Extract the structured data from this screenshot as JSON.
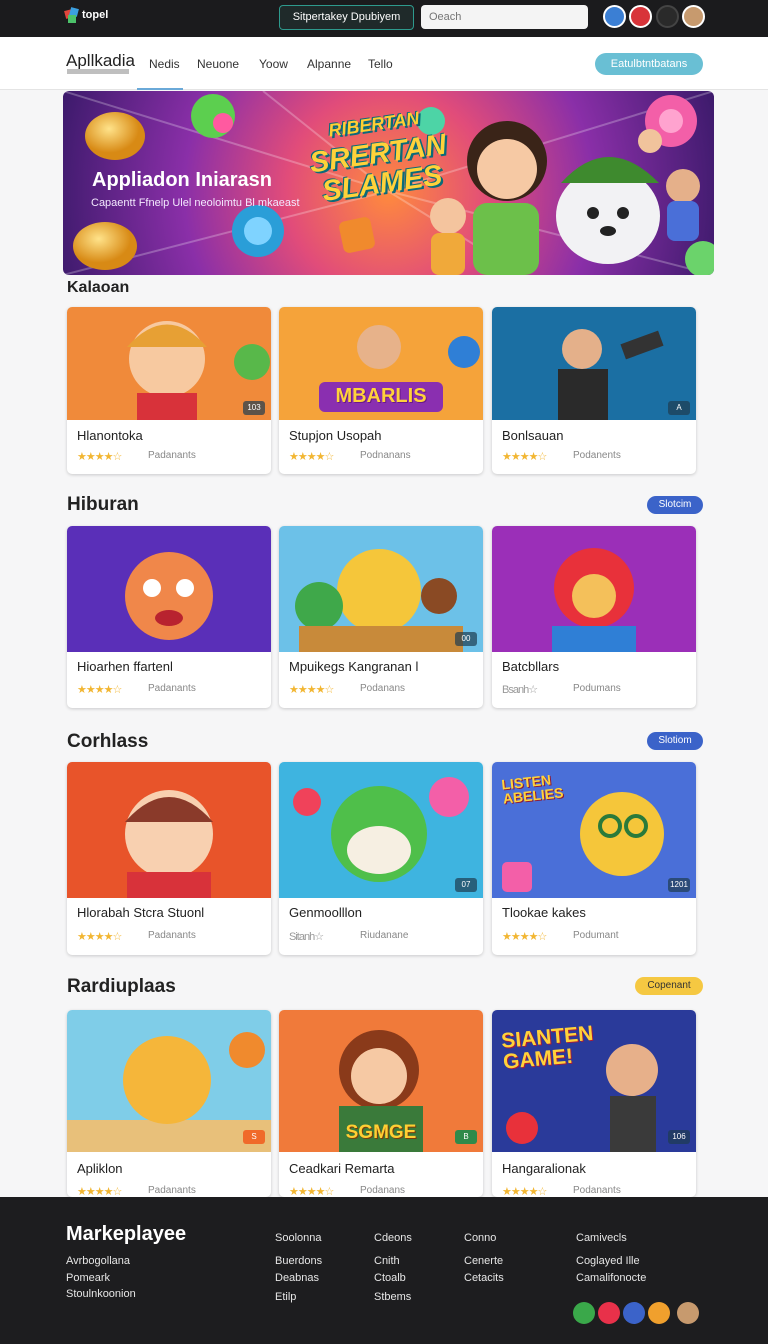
{
  "topbar": {
    "logo_text": "topel",
    "button_label": "Sitpertakey Dpubiyem",
    "search_placeholder": "Oeach",
    "avatars": [
      "avatar-1",
      "avatar-2",
      "avatar-3",
      "avatar-4"
    ]
  },
  "nav": {
    "brand": "Apllkadia",
    "items": [
      "Nedis",
      "Neuone",
      "Yoow",
      "Alpanne",
      "Tello"
    ],
    "cta_label": "Eatulbtntbatans"
  },
  "hero": {
    "title": "Appliadon Iniarasn",
    "subtitle": "Capaentt Ffnelp Ulel neoloimtu Bl mkaeast",
    "logo_line1": "RIBERTAN",
    "logo_line2": "SRERTAN",
    "logo_line3": "SLAMES"
  },
  "sections": [
    {
      "title": "Kalaoan",
      "badge": "",
      "cards": [
        {
          "name": "Hlanontoka",
          "meta": "Padanants",
          "chip": "103",
          "stars": "★★★★☆"
        },
        {
          "name": "Stupjon Usopah",
          "meta": "Podnanans",
          "chip": "",
          "stars": "★★★★☆",
          "banner": "MBARLIS"
        },
        {
          "name": "Bonlsauan",
          "meta": "Podanents",
          "chip": "A",
          "stars": "★★★★☆"
        }
      ]
    },
    {
      "title": "Hiburan",
      "badge": "Slotcim",
      "cards": [
        {
          "name": "Hioarhen ffartenl",
          "meta": "Padanants",
          "chip": "",
          "stars": "★★★★☆"
        },
        {
          "name": "Mpuikegs Kangranan l",
          "meta": "Podanans",
          "chip": "00",
          "stars": "★★★★☆"
        },
        {
          "name": "Batcbllars",
          "meta": "Podumans",
          "chip": "",
          "stars": "Bsanh☆"
        }
      ]
    },
    {
      "title": "Corhlass",
      "badge": "Slotiom",
      "cards": [
        {
          "name": "Hlorabah Stcra Stuonl",
          "meta": "Padanants",
          "chip": "",
          "stars": "★★★★☆"
        },
        {
          "name": "Genmoolllon",
          "meta": "Riudanane",
          "chip": "07",
          "stars": "Sitanh☆"
        },
        {
          "name": "Tlookae kakes",
          "meta": "Podumant",
          "chip": "1201",
          "stars": "★★★★☆",
          "banner": "LISTEN ABELIES"
        }
      ]
    },
    {
      "title": "Rardiuplaas",
      "badge": "Copenant",
      "cards": [
        {
          "name": "Apliklon",
          "meta": "Padanants",
          "chip": "S",
          "stars": "★★★★☆"
        },
        {
          "name": "Ceadkari Remarta",
          "meta": "Podanans",
          "chip": "B",
          "stars": "★★★★☆",
          "banner": "SGMGE"
        },
        {
          "name": "Hangaralionak",
          "meta": "Podanants",
          "chip": "106",
          "stars": "★★★★☆",
          "banner": "SIANTEN GAME!"
        }
      ]
    }
  ],
  "footer": {
    "brand": "Markeplayee",
    "col1": [
      "Avrbogollana",
      "Pomeark",
      "Stoulnkoonion"
    ],
    "col2": [
      "Soolonna",
      "Buerdons",
      "Deabnas",
      "Etilp"
    ],
    "col3": [
      "Cdeons",
      "Cnith",
      "Ctoalb",
      "Stbems"
    ],
    "col4": [
      "Conno",
      "Cenerte",
      "Cetacits"
    ],
    "col5": [
      "Camivecls",
      "Coglayed Ille",
      "Camalifonocte"
    ],
    "icons": [
      "whatsapp-icon",
      "pinterest-icon",
      "facebook-icon",
      "youtube-icon",
      "profile-icon"
    ]
  },
  "colors": {
    "accent_teal": "#69bfd4",
    "badge_blue": "#3b63c9",
    "badge_yellow": "#f5c842",
    "star": "#f2b632"
  }
}
